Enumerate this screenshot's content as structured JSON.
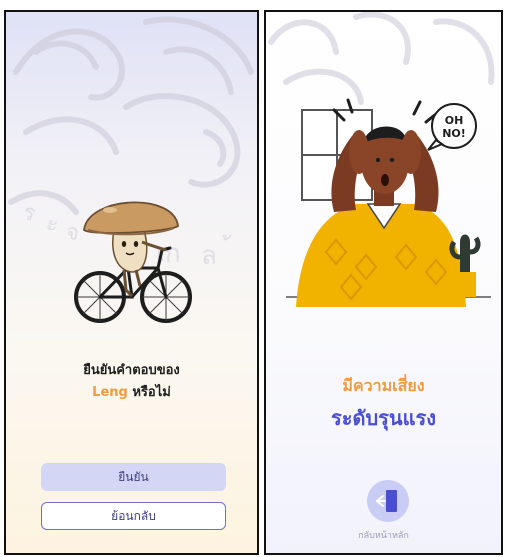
{
  "confirm_screen": {
    "question_line1": "ยืนยันคำตอบของ",
    "question_name": "Leng",
    "question_suffix": " หรือไม่",
    "confirm_button": "ยืนยัน",
    "back_button": "ย้อนกลับ",
    "mascot_icon": "mushroom-on-bicycle-icon"
  },
  "result_screen": {
    "speech_bubble": "OH NO!",
    "speech_line1": "OH",
    "speech_line2": "NO!",
    "risk_line1": "มีความเสี่ยง",
    "risk_line2": "ระดับรุนแรง",
    "home_label": "กลับหน้าหลัก",
    "home_icon": "exit-door-icon",
    "illustration": "shocked-man-illustration"
  },
  "colors": {
    "accent_orange": "#f19a3e",
    "accent_indigo": "#4a4ed0",
    "button_fill": "#d4d6f6",
    "button_text": "#3d3f86"
  }
}
